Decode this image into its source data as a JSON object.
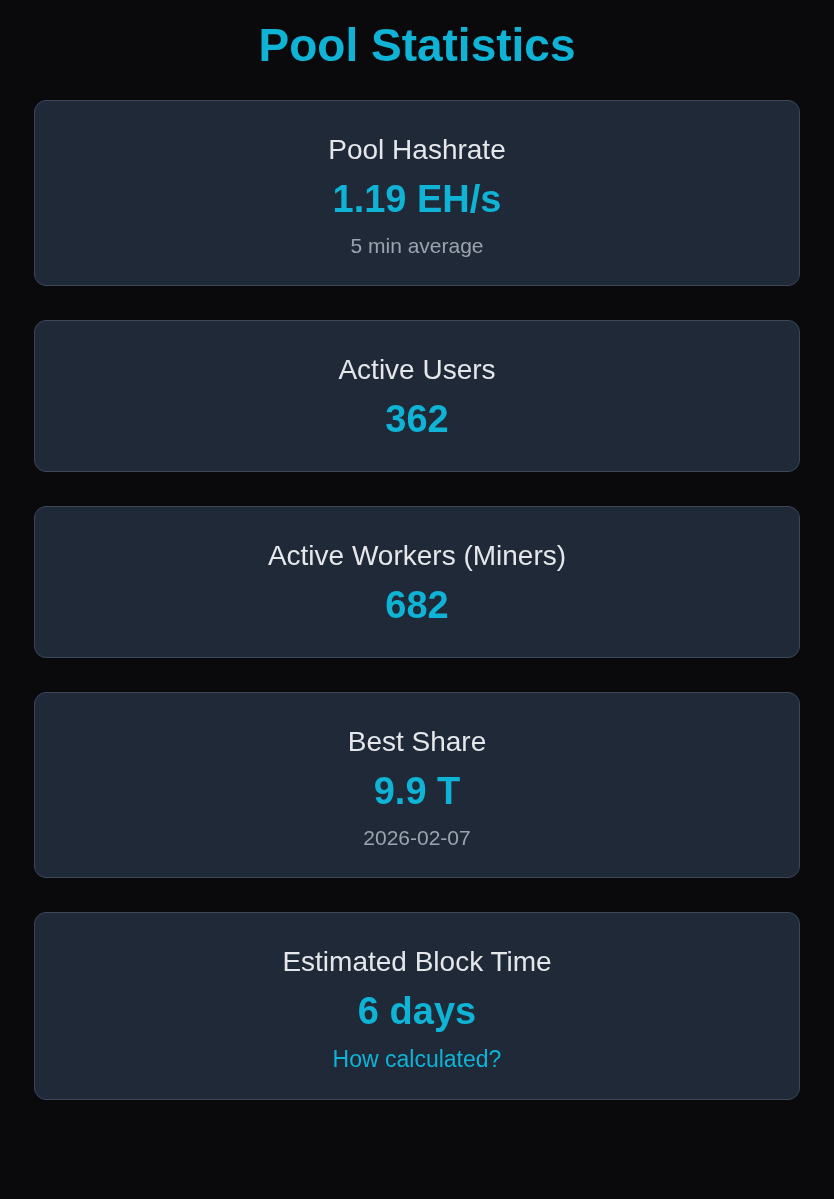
{
  "title": "Pool Statistics",
  "cards": [
    {
      "label": "Pool Hashrate",
      "value": "1.19 EH/s",
      "note": {
        "kind": "text",
        "text": "5 min average"
      }
    },
    {
      "label": "Active Users",
      "value": "362"
    },
    {
      "label": "Active Workers (Miners)",
      "value": "682"
    },
    {
      "label": "Best Share",
      "value": "9.9 T",
      "note": {
        "kind": "text",
        "text": "2026-02-07"
      }
    },
    {
      "label": "Estimated Block Time",
      "value": "6 days",
      "note": {
        "kind": "link",
        "text": "How calculated?"
      }
    }
  ]
}
